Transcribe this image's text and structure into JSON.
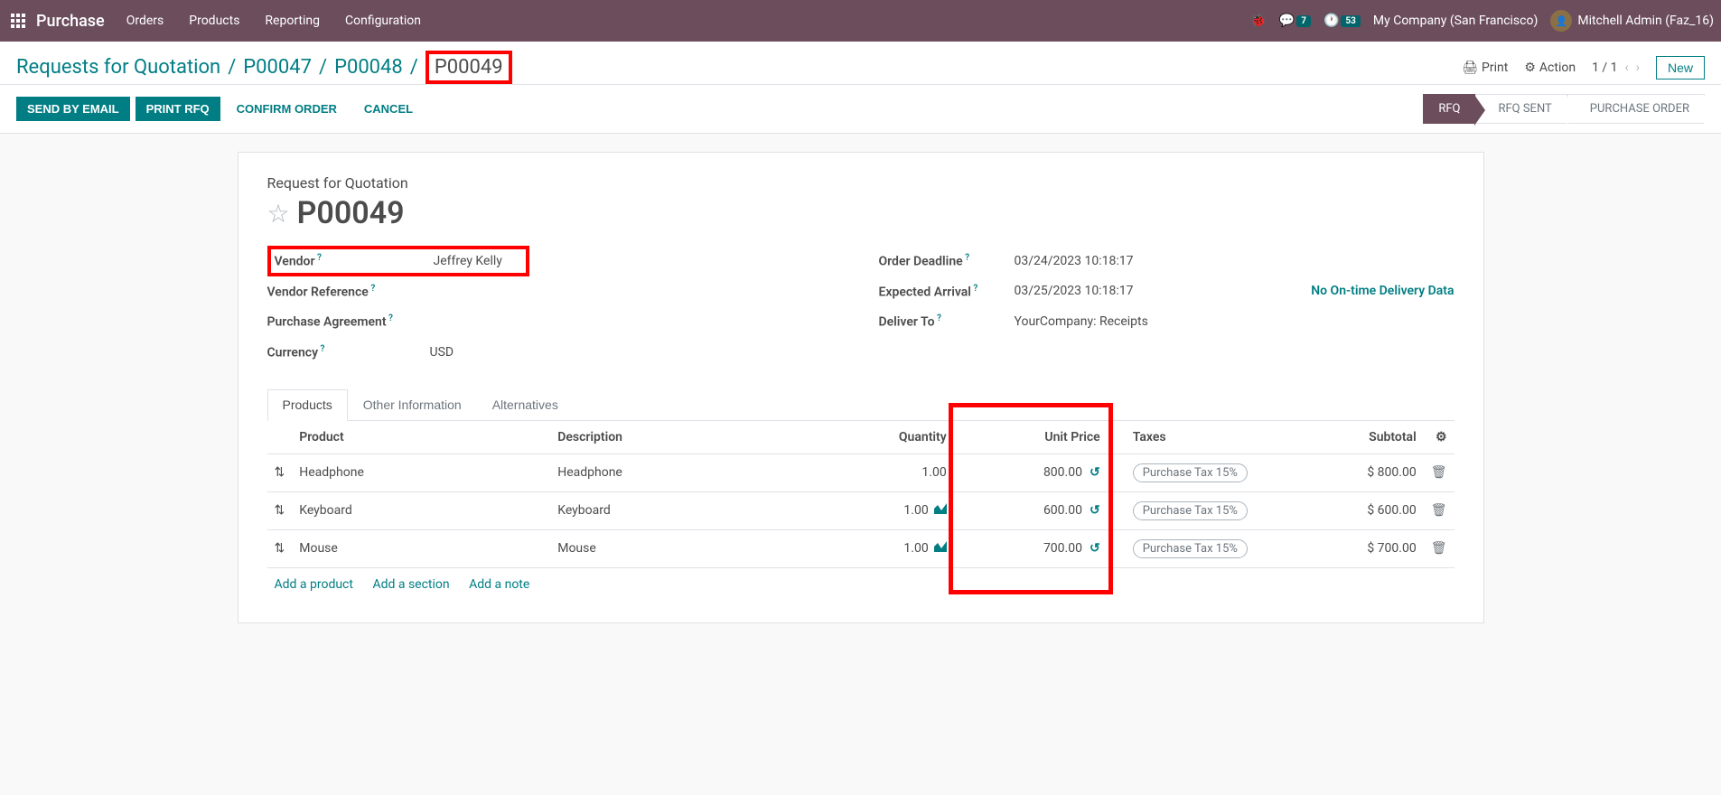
{
  "navbar": {
    "brand": "Purchase",
    "menu": [
      "Orders",
      "Products",
      "Reporting",
      "Configuration"
    ],
    "chat_badge": "7",
    "activity_badge": "53",
    "company": "My Company (San Francisco)",
    "user": "Mitchell Admin (Faz_16)"
  },
  "controls": {
    "breadcrumb": [
      "Requests for Quotation",
      "P00047",
      "P00048"
    ],
    "breadcrumb_current": "P00049",
    "print": "Print",
    "action": "Action",
    "pager": "1 / 1",
    "new": "New"
  },
  "actions": {
    "send_email": "SEND BY EMAIL",
    "print_rfq": "PRINT RFQ",
    "confirm": "CONFIRM ORDER",
    "cancel": "CANCEL"
  },
  "status": [
    "RFQ",
    "RFQ SENT",
    "PURCHASE ORDER"
  ],
  "doc": {
    "label": "Request for Quotation",
    "name": "P00049",
    "vendor_label": "Vendor",
    "vendor": "Jeffrey Kelly",
    "vendor_ref_label": "Vendor Reference",
    "agreement_label": "Purchase Agreement",
    "currency_label": "Currency",
    "currency": "USD",
    "deadline_label": "Order Deadline",
    "deadline": "03/24/2023 10:18:17",
    "arrival_label": "Expected Arrival",
    "arrival": "03/25/2023 10:18:17",
    "ontime": "No On-time Delivery Data",
    "deliver_label": "Deliver To",
    "deliver": "YourCompany: Receipts"
  },
  "tabs": [
    "Products",
    "Other Information",
    "Alternatives"
  ],
  "table": {
    "headers": {
      "product": "Product",
      "description": "Description",
      "quantity": "Quantity",
      "unit_price": "Unit Price",
      "taxes": "Taxes",
      "subtotal": "Subtotal"
    },
    "rows": [
      {
        "product": "Headphone",
        "description": "Headphone",
        "qty": "1.00",
        "chart": false,
        "price": "800.00",
        "tax": "Purchase Tax 15%",
        "subtotal": "$ 800.00"
      },
      {
        "product": "Keyboard",
        "description": "Keyboard",
        "qty": "1.00",
        "chart": true,
        "price": "600.00",
        "tax": "Purchase Tax 15%",
        "subtotal": "$ 600.00"
      },
      {
        "product": "Mouse",
        "description": "Mouse",
        "qty": "1.00",
        "chart": true,
        "price": "700.00",
        "tax": "Purchase Tax 15%",
        "subtotal": "$ 700.00"
      }
    ],
    "add_product": "Add a product",
    "add_section": "Add a section",
    "add_note": "Add a note"
  }
}
